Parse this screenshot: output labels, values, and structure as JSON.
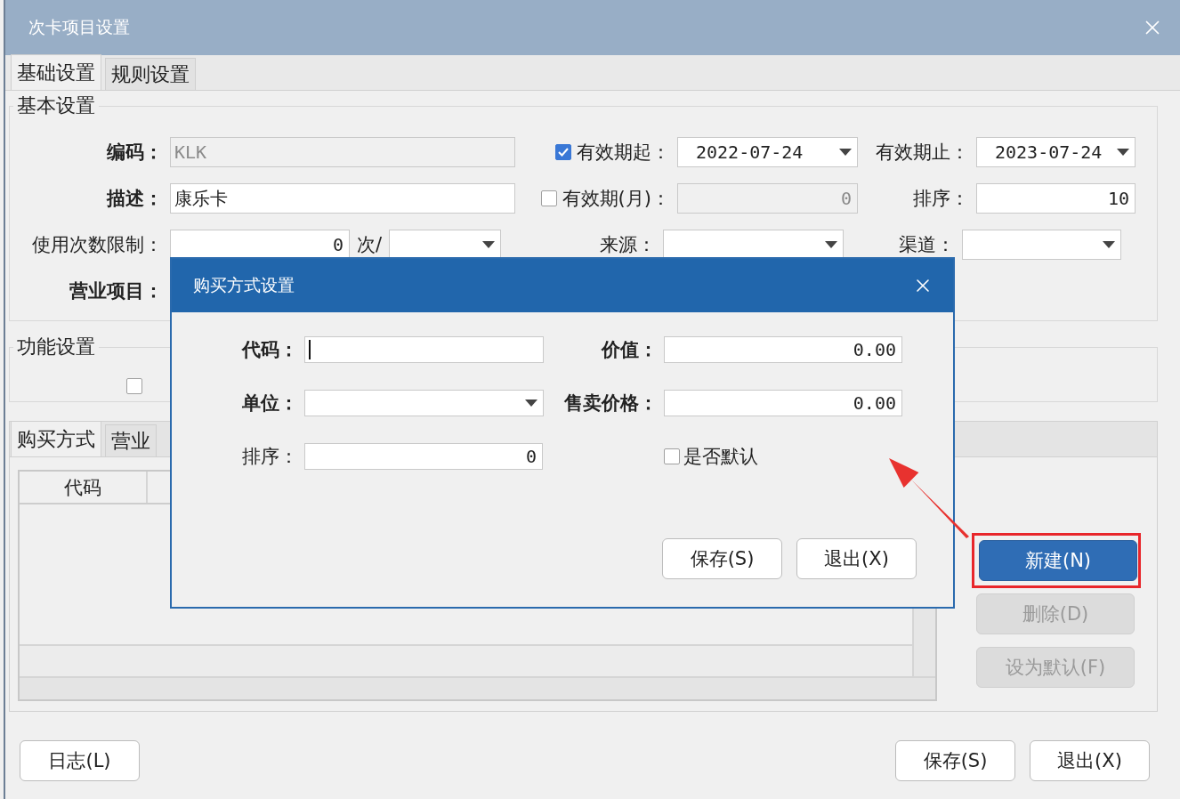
{
  "window": {
    "title": "次卡项目设置"
  },
  "tabs": [
    {
      "label": "基础设置",
      "selected": true
    },
    {
      "label": "规则设置",
      "selected": false
    }
  ],
  "basic_settings": {
    "title": "基本设置",
    "rows": [
      [
        {
          "kind": "text",
          "label": "编码：",
          "bold": true,
          "value": "KLK",
          "disabled": true
        },
        {
          "kind": "select",
          "label": "有效期起：",
          "bold": false,
          "checked": true,
          "value": "2022-07-24"
        },
        {
          "kind": "select",
          "label": "有效期止：",
          "bold": false,
          "value": "2023-07-24"
        }
      ],
      [
        {
          "kind": "text",
          "label": "描述：",
          "bold": true,
          "value": "康乐卡",
          "disabled": false
        },
        {
          "kind": "number",
          "label": "有效期(月)：",
          "bold": false,
          "checked": false,
          "value": "0",
          "disabled": true
        },
        {
          "kind": "number",
          "label": "排序：",
          "bold": false,
          "value": "10",
          "disabled": false
        }
      ],
      [
        {
          "kind": "count",
          "label": "使用次数限制：",
          "bold": false,
          "value": "0",
          "unit": "次/"
        },
        {
          "kind": "select",
          "label": "来源：",
          "bold": false
        },
        {
          "kind": "select",
          "label": "渠道：",
          "bold": false
        }
      ],
      [
        {
          "kind": "label",
          "label": "营业项目：",
          "bold": true
        }
      ]
    ]
  },
  "function_settings": {
    "title": "功能设置",
    "checkboxes": [
      {
        "checked": false
      }
    ]
  },
  "detail_panel": {
    "tabs": [
      {
        "label": "购买方式",
        "selected": true
      },
      {
        "label": "营业",
        "selected": false
      }
    ],
    "table": {
      "columns": [
        "代码"
      ]
    },
    "buttons": [
      {
        "label": "新建(N)",
        "kind": "primary",
        "highlighted": true
      },
      {
        "label": "删除(D)",
        "kind": "disabled",
        "highlighted": false
      },
      {
        "label": "设为默认(F)",
        "kind": "disabled",
        "highlighted": false
      }
    ]
  },
  "footer": {
    "left": [
      "日志(L)"
    ],
    "right": [
      "保存(S)",
      "退出(X)"
    ]
  },
  "dialog": {
    "title": "购买方式设置",
    "fields": [
      {
        "kind": "text",
        "label": "代码：",
        "bold": true,
        "focused": true
      },
      {
        "kind": "number",
        "label": "价值：",
        "bold": true,
        "value": "0.00",
        "focused": false
      },
      {
        "kind": "select",
        "label": "单位：",
        "bold": true
      },
      {
        "kind": "number",
        "label": "售卖价格：",
        "bold": true,
        "value": "0.00",
        "focused": false
      },
      {
        "kind": "number",
        "label": "排序：",
        "bold": false,
        "value": "0",
        "focused": false
      },
      {
        "kind": "check",
        "label": "是否默认",
        "checked": false
      }
    ],
    "buttons": [
      "保存(S)",
      "退出(X)"
    ]
  }
}
